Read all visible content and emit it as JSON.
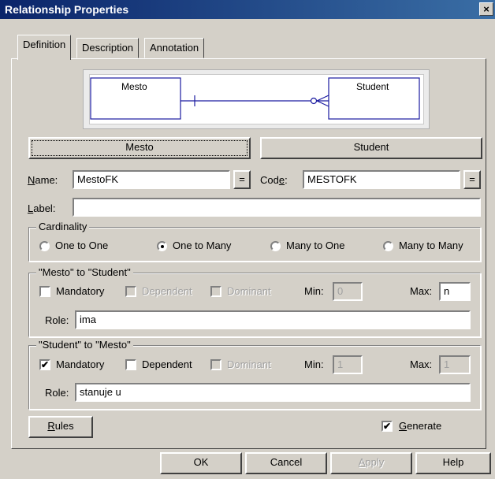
{
  "window": {
    "title": "Relationship Properties",
    "close_glyph": "×"
  },
  "tabs": [
    {
      "label": "Definition",
      "active": true
    },
    {
      "label": "Description",
      "active": false
    },
    {
      "label": "Annotation",
      "active": false
    }
  ],
  "diagram": {
    "left_entity": "Mesto",
    "right_entity": "Student"
  },
  "entity_buttons": {
    "left": "Mesto",
    "right": "Student"
  },
  "name": {
    "label": "Name:",
    "value": "MestoFK",
    "eq": "="
  },
  "code": {
    "label": "Code:",
    "value": "MESTOFK",
    "eq": "="
  },
  "label_field": {
    "label": "Label:",
    "value": ""
  },
  "cardinality": {
    "title": "Cardinality",
    "options": [
      "One to One",
      "One to Many",
      "Many to One",
      "Many to Many"
    ],
    "selected": "One to Many"
  },
  "role1": {
    "title": "\"Mesto\" to \"Student\"",
    "mandatory": {
      "label": "Mandatory",
      "checked": false
    },
    "dependent": {
      "label": "Dependent",
      "checked": false,
      "enabled": false
    },
    "dominant": {
      "label": "Dominant",
      "checked": false,
      "enabled": false
    },
    "min_label": "Min:",
    "min_value": "0",
    "max_label": "Max:",
    "max_value": "n",
    "role_label": "Role:",
    "role_value": "ima"
  },
  "role2": {
    "title": "\"Student\" to \"Mesto\"",
    "mandatory": {
      "label": "Mandatory",
      "checked": true
    },
    "dependent": {
      "label": "Dependent",
      "checked": false,
      "enabled": true
    },
    "dominant": {
      "label": "Dominant",
      "checked": false,
      "enabled": false
    },
    "min_label": "Min:",
    "min_value": "1",
    "max_label": "Max:",
    "max_value": "1",
    "role_label": "Role:",
    "role_value": "stanuje u"
  },
  "rules_button": "Rules",
  "generate": {
    "label": "Generate",
    "checked": true
  },
  "footer": {
    "ok": "OK",
    "cancel": "Cancel",
    "apply": "Apply",
    "help": "Help"
  },
  "check_glyph": "✔"
}
